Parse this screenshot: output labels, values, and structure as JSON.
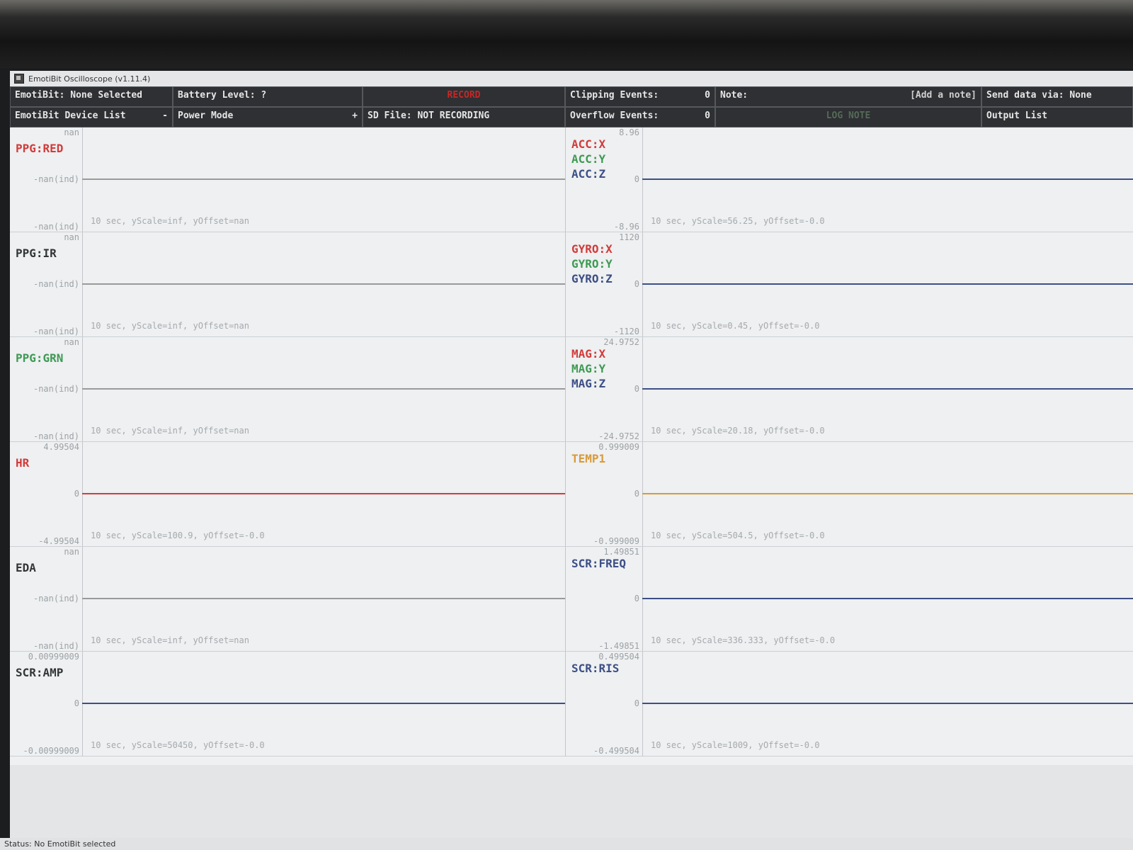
{
  "window": {
    "title": "EmotiBit Oscilloscope (v1.11.4)"
  },
  "toolbar": {
    "device_selected": "EmotiBit: None Selected",
    "battery_level": "Battery Level: ?",
    "record": "RECORD",
    "clipping_label": "Clipping Events:",
    "clipping_value": "0",
    "note_label": "Note:",
    "note_placeholder": "[Add a note]",
    "send_data": "Send data via: None",
    "device_list": "EmotiBit Device List",
    "device_list_toggle": "-",
    "power_mode": "Power Mode",
    "power_mode_toggle": "+",
    "sd_file": "SD File: NOT RECORDING",
    "overflow_label": "Overflow Events:",
    "overflow_value": "0",
    "log_note": "LOG NOTE",
    "output_list": "Output List"
  },
  "colors": {
    "red": "#d23b3b",
    "green": "#3f9a55",
    "blue": "#3d4f86",
    "orange": "#d99a3a",
    "dark": "#333638"
  },
  "plots_left": [
    {
      "labels": [
        {
          "text": "PPG:RED",
          "color": "#d23b3b"
        }
      ],
      "ymax": "nan",
      "ymid": "-nan(ind)",
      "ymin": "-nan(ind)",
      "trace": "#9a9a9a",
      "info": "10 sec, yScale=inf, yOffset=nan"
    },
    {
      "labels": [
        {
          "text": "PPG:IR",
          "color": "#333638"
        }
      ],
      "ymax": "nan",
      "ymid": "-nan(ind)",
      "ymin": "-nan(ind)",
      "trace": "#9a9a9a",
      "info": "10 sec, yScale=inf, yOffset=nan"
    },
    {
      "labels": [
        {
          "text": "PPG:GRN",
          "color": "#3f9a55"
        }
      ],
      "ymax": "nan",
      "ymid": "-nan(ind)",
      "ymin": "-nan(ind)",
      "trace": "#9a9a9a",
      "info": "10 sec, yScale=inf, yOffset=nan"
    },
    {
      "labels": [
        {
          "text": "HR",
          "color": "#d23b3b"
        }
      ],
      "ymax": "4.99504",
      "ymid": "0",
      "ymin": "-4.99504",
      "trace": "#d23b3b",
      "info": "10 sec, yScale=100.9, yOffset=-0.0"
    },
    {
      "labels": [
        {
          "text": "EDA",
          "color": "#333638"
        }
      ],
      "ymax": "nan",
      "ymid": "-nan(ind)",
      "ymin": "-nan(ind)",
      "trace": "#9a9a9a",
      "info": "10 sec, yScale=inf, yOffset=nan"
    },
    {
      "labels": [
        {
          "text": "SCR:AMP",
          "color": "#333638"
        }
      ],
      "ymax": "0.00999009",
      "ymid": "0",
      "ymin": "-0.00999009",
      "trace": "#3d4f86",
      "info": "10 sec, yScale=50450, yOffset=-0.0"
    }
  ],
  "plots_right": [
    {
      "labels": [
        {
          "text": "ACC:X",
          "color": "#d23b3b"
        },
        {
          "text": "ACC:Y",
          "color": "#3f9a55"
        },
        {
          "text": "ACC:Z",
          "color": "#3d4f86"
        }
      ],
      "ymax": "8.96",
      "ymid": "0",
      "ymin": "-8.96",
      "trace": "#3d4f86",
      "info": "10 sec, yScale=56.25, yOffset=-0.0"
    },
    {
      "labels": [
        {
          "text": "GYRO:X",
          "color": "#d23b3b"
        },
        {
          "text": "GYRO:Y",
          "color": "#3f9a55"
        },
        {
          "text": "GYRO:Z",
          "color": "#3d4f86"
        }
      ],
      "ymax": "1120",
      "ymid": "0",
      "ymin": "-1120",
      "trace": "#3d4f86",
      "info": "10 sec, yScale=0.45, yOffset=-0.0"
    },
    {
      "labels": [
        {
          "text": "MAG:X",
          "color": "#d23b3b"
        },
        {
          "text": "MAG:Y",
          "color": "#3f9a55"
        },
        {
          "text": "MAG:Z",
          "color": "#3d4f86"
        }
      ],
      "ymax": "24.9752",
      "ymid": "0",
      "ymin": "-24.9752",
      "trace": "#3d4f86",
      "info": "10 sec, yScale=20.18, yOffset=-0.0"
    },
    {
      "labels": [
        {
          "text": "TEMP1",
          "color": "#d99a3a"
        }
      ],
      "ymax": "0.999009",
      "ymid": "0",
      "ymin": "-0.999009",
      "trace": "#d99a3a",
      "info": "10 sec, yScale=504.5, yOffset=-0.0"
    },
    {
      "labels": [
        {
          "text": "SCR:FREQ",
          "color": "#3d4f86"
        }
      ],
      "ymax": "1.49851",
      "ymid": "0",
      "ymin": "-1.49851",
      "trace": "#3d4f86",
      "info": "10 sec, yScale=336.333, yOffset=-0.0"
    },
    {
      "labels": [
        {
          "text": "SCR:RIS",
          "color": "#3d4f86"
        }
      ],
      "ymax": "0.499504",
      "ymid": "0",
      "ymin": "-0.499504",
      "trace": "#3d4f86",
      "info": "10 sec, yScale=1009, yOffset=-0.0"
    }
  ],
  "status": {
    "text": "Status: No EmotiBit selected"
  }
}
